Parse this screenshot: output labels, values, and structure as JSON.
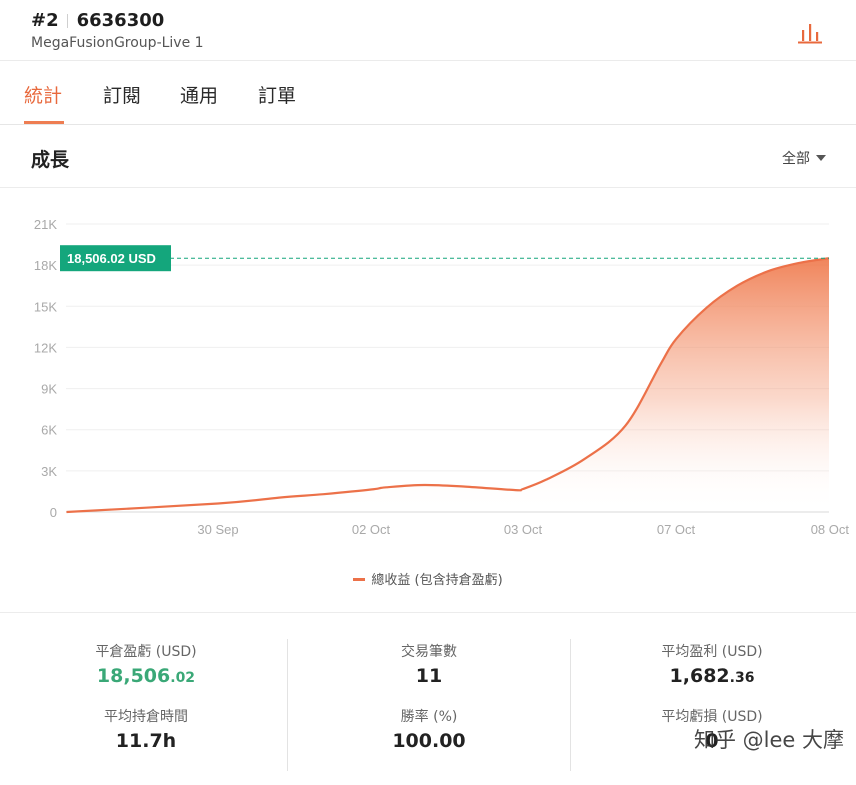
{
  "header": {
    "account_rank": "#2",
    "account_number": "6636300",
    "server": "MegaFusionGroup-Live 1",
    "icon": "bar-chart-icon"
  },
  "tabs": [
    {
      "label": "統計",
      "active": true
    },
    {
      "label": "訂閱",
      "active": false
    },
    {
      "label": "通用",
      "active": false
    },
    {
      "label": "訂單",
      "active": false
    }
  ],
  "section": {
    "title": "成長",
    "range": "全部"
  },
  "colors": {
    "accent": "#e8693d",
    "line": "#ec7149",
    "badge": "#14a67c",
    "green": "#3aa877"
  },
  "chart_data": {
    "type": "area",
    "title": "",
    "xlabel": "",
    "ylabel": "",
    "x_ticks": [
      "30 Sep",
      "02 Oct",
      "03 Oct",
      "07 Oct",
      "08 Oct"
    ],
    "y_ticks": [
      "0",
      "3K",
      "6K",
      "9K",
      "12K",
      "15K",
      "18K",
      "21K"
    ],
    "ylim": [
      0,
      21000
    ],
    "current_label": "18,506.02 USD",
    "current_value": 18506.02,
    "grid": true,
    "legend_position": "bottom",
    "series": [
      {
        "name": "總收益 (包含持倉盈虧)",
        "x_index": [
          -0.99,
          0,
          0.4,
          0.69,
          1,
          1.1,
          1.35,
          1.62,
          1.95,
          2,
          2.15,
          2.4,
          2.67,
          2.9,
          3,
          3.2,
          3.4,
          3.6,
          3.8,
          4
        ],
        "values": [
          0,
          620,
          1050,
          1300,
          1640,
          1800,
          1970,
          1850,
          1600,
          1680,
          2350,
          3850,
          6300,
          10800,
          12600,
          14900,
          16500,
          17550,
          18150,
          18506
        ]
      }
    ]
  },
  "stats": [
    {
      "label": "平倉盈虧 (USD)",
      "int": "18,506",
      "dec": ".02",
      "green": true
    },
    {
      "label": "交易筆數",
      "int": "11",
      "dec": ""
    },
    {
      "label": "平均盈利 (USD)",
      "int": "1,682",
      "dec": ".36"
    },
    {
      "label": "平均持倉時間",
      "int": "11.7h",
      "dec": ""
    },
    {
      "label": "勝率 (%)",
      "int": "100.00",
      "dec": ""
    },
    {
      "label": "平均虧損 (USD)",
      "int": "0",
      "dec": ""
    }
  ],
  "watermark": "知乎 @lee 大摩"
}
